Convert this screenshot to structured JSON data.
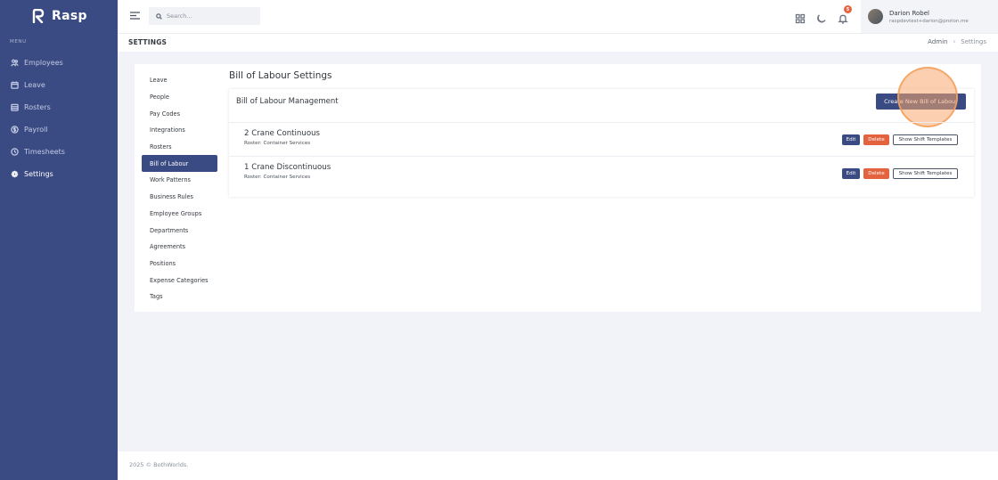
{
  "brand": {
    "name": "Rasp"
  },
  "sidebar": {
    "menu_title": "MENU",
    "items": [
      {
        "label": "Employees",
        "icon": "people-icon"
      },
      {
        "label": "Leave",
        "icon": "calendar-icon"
      },
      {
        "label": "Rosters",
        "icon": "roster-icon"
      },
      {
        "label": "Payroll",
        "icon": "dollar-icon"
      },
      {
        "label": "Timesheets",
        "icon": "clock-icon"
      },
      {
        "label": "Settings",
        "icon": "gear-icon",
        "active": true
      }
    ]
  },
  "topbar": {
    "search_placeholder": "Search...",
    "notification_count": "5",
    "user": {
      "name": "Darion Robel",
      "email": "raspdevtest+darion@proton.me"
    }
  },
  "pagebar": {
    "title": "SETTINGS",
    "breadcrumb": [
      "Admin",
      "Settings"
    ]
  },
  "settings_nav": {
    "items": [
      "Leave",
      "People",
      "Pay Codes",
      "Integrations",
      "Rosters",
      "Bill of Labour",
      "Work Patterns",
      "Business Rules",
      "Employee Groups",
      "Departments",
      "Agreements",
      "Positions",
      "Expense Categories",
      "Tags"
    ],
    "active": "Bill of Labour"
  },
  "main": {
    "title": "Bill of Labour Settings",
    "panel_title": "Bill of Labour Management",
    "create_label": "Create New Bill of Labour",
    "edit_label": "Edit",
    "delete_label": "Delete",
    "templates_label": "Show Shift Templates",
    "bills": [
      {
        "name": "2 Crane Continuous",
        "roster": "Roster: Container Services"
      },
      {
        "name": "1 Crane Discontinuous",
        "roster": "Roster: Container Services"
      }
    ]
  },
  "footer": {
    "text": "2025 © BothWorlds."
  },
  "colors": {
    "primary": "#3a4a82",
    "danger": "#e4633f",
    "background": "#f2f3f8"
  }
}
